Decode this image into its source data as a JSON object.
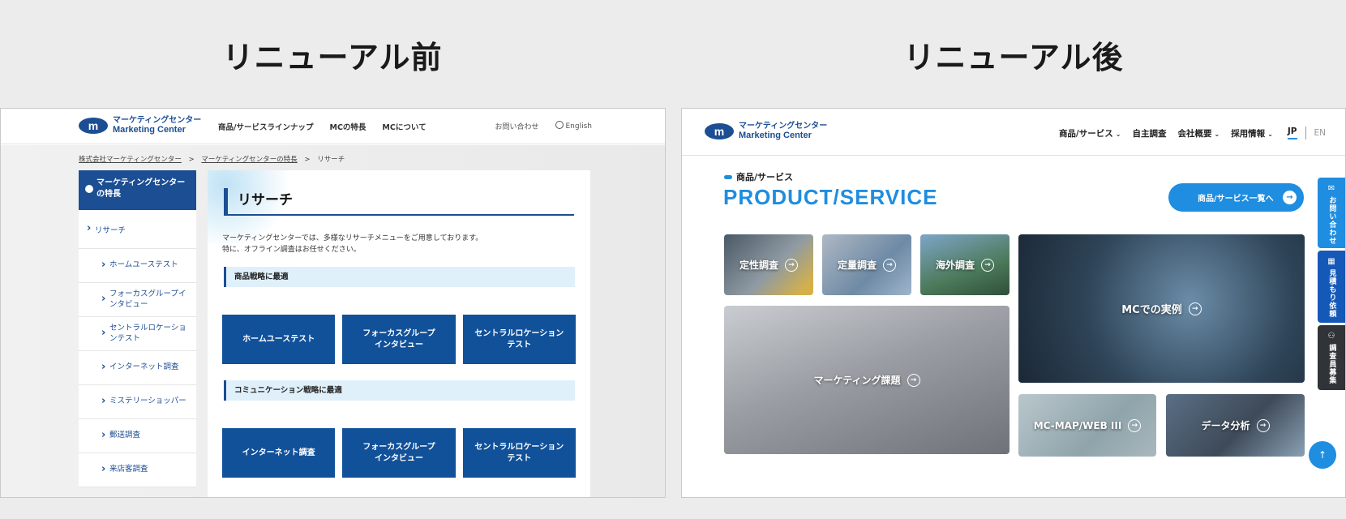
{
  "headings": {
    "before": "リニューアル前",
    "after": "リニューアル後"
  },
  "logo": {
    "mark": "m",
    "jp": "マーケティングセンター",
    "en": "Marketing Center"
  },
  "old_site": {
    "nav": [
      "商品/サービスラインナップ",
      "MCの特長",
      "MCについて"
    ],
    "util": {
      "contact": "お問い合わせ",
      "english": "English"
    },
    "breadcrumb": {
      "home": "株式会社マーケティングセンター",
      "parent": "マーケティングセンターの特長",
      "current": "リサーチ",
      "sep": ">"
    },
    "sidebar": {
      "head": "マーケティングセンターの特長",
      "items": [
        "リサーチ",
        "ホームユーステスト",
        "フォーカスグループインタビュー",
        "セントラルロケーションテスト",
        "インターネット調査",
        "ミステリーショッパー",
        "郵送調査",
        "来店客調査"
      ]
    },
    "main": {
      "title": "リサーチ",
      "intro_1": "マーケティングセンターでは、多様なリサーチメニューをご用意しております。",
      "intro_2": "特に、オフライン調査はお任せください。",
      "section1": "商品戦略に最適",
      "section1_buttons": [
        "ホームユーステスト",
        "フォーカスグループ\nインタビュー",
        "セントラルロケーション\nテスト"
      ],
      "section2": "コミュニケーション戦略に最適",
      "section2_buttons": [
        "インターネット調査",
        "フォーカスグループ\nインタビュー",
        "セントラルロケーション\nテスト"
      ]
    }
  },
  "new_site": {
    "nav": {
      "products": "商品/サービス",
      "own_research": "自主調査",
      "company": "会社概要",
      "recruit": "採用情報",
      "jp": "JP",
      "en": "EN",
      "caret": "⌄"
    },
    "section_label": "商品/サービス",
    "section_title": "PRODUCT/SERVICE",
    "cta": "商品/サービス一覧へ",
    "arrow": "→",
    "tiles": {
      "qualitative": "定性調査",
      "quantitative": "定量調査",
      "overseas": "海外調査",
      "marketing": "マーケティング課題",
      "cases": "MCでの実例",
      "map": "MC-MAP/WEB III",
      "analysis": "データ分析"
    },
    "float_tabs": {
      "contact": "お問い合わせ",
      "estimate": "見積もり依頼",
      "recruit": "調査員募集"
    },
    "to_top": "↑"
  }
}
